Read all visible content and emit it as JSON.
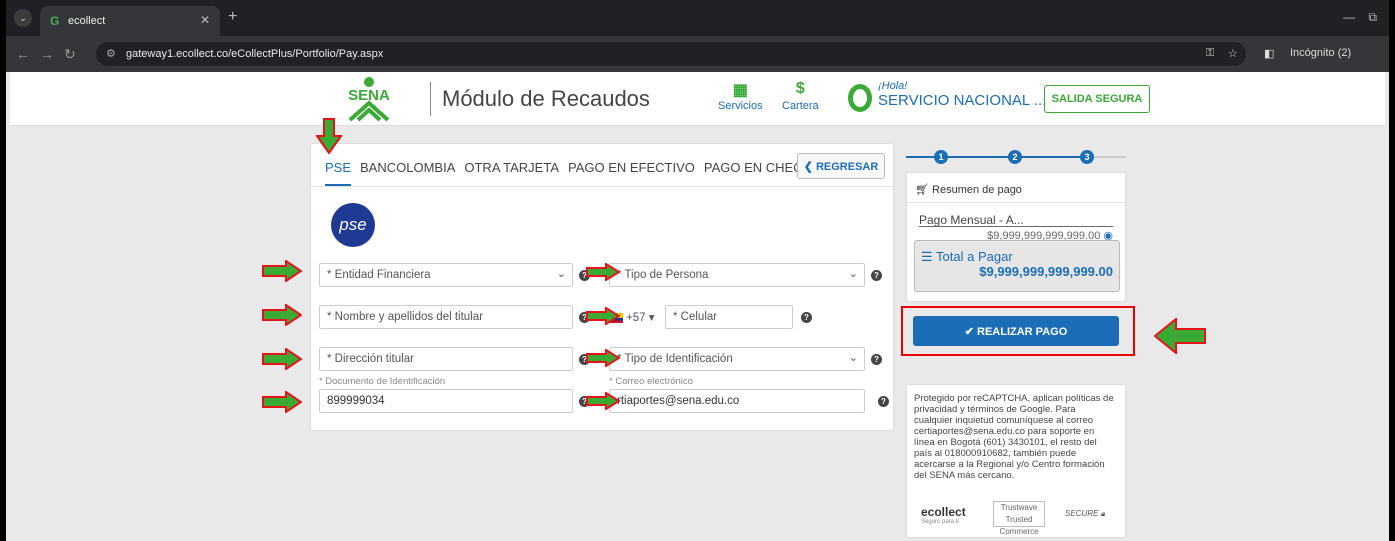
{
  "browser": {
    "tab_title": "ecollect",
    "url": "gateway1.ecollect.co/eCollectPlus/Portfolio/Pay.aspx",
    "incognito_label": "Incógnito (2)"
  },
  "header": {
    "logo_text": "SENA",
    "module_title": "Módulo de Recaudos",
    "servicios_label": "Servicios",
    "cartera_label": "Cartera",
    "greeting": "¡Hola!",
    "user_name": "SERVICIO NACIONAL ...",
    "logout_label": "SALIDA SEGURA"
  },
  "payment_tabs": [
    "PSE",
    "BANCOLOMBIA",
    "OTRA TARJETA",
    "PAGO EN EFECTIVO",
    "PAGO EN CHEQUE"
  ],
  "back_label": "REGRESAR",
  "pse_logo": "pse",
  "form": {
    "entidad": "* Entidad Financiera",
    "tipo_persona": "* Tipo de Persona",
    "nombre_placeholder": "* Nombre y apellidos del titular",
    "phone_code": "+57",
    "celular_placeholder": "* Celular",
    "direccion_placeholder": "* Dirección titular",
    "tipo_id": "* Tipo de Identificación",
    "documento_label": "* Documento de Identificación",
    "documento_value": "899999034",
    "correo_label": "* Correo electrónico",
    "correo_value": "rtiaportes@sena.edu.co"
  },
  "steps": [
    "1",
    "2",
    "3"
  ],
  "summary": {
    "heading": "Resumen de pago",
    "item": "Pago Mensual - A...",
    "item_amount": "$9,999,999,999,999.00",
    "total_label": "Total a Pagar",
    "total_amount": "$9,999,999,999,999.00"
  },
  "pay_button": "REALIZAR PAGO",
  "info": {
    "text": "Protegido por reCAPTCHA, aplican políticas de privacidad y términos de Google. Para cualquier inquietud comuníquese al correo certiaportes@sena.edu.co para soporte en línea en Bogotá (601) 3430101, el resto del país al 018000910682, también puede acercarse a la Regional y/o Centro formación del SENA más cercano.",
    "ecollect": "ecollect",
    "ecollect_tag": "Seguro para ti",
    "trustwave": "Trustwave",
    "trustwave_sub": "Trusted Commerce",
    "secure": "SECURE"
  },
  "colors": {
    "arrow_red": "#e8121b",
    "arrow_green": "#3aaa35",
    "primary": "#1b6db5"
  }
}
